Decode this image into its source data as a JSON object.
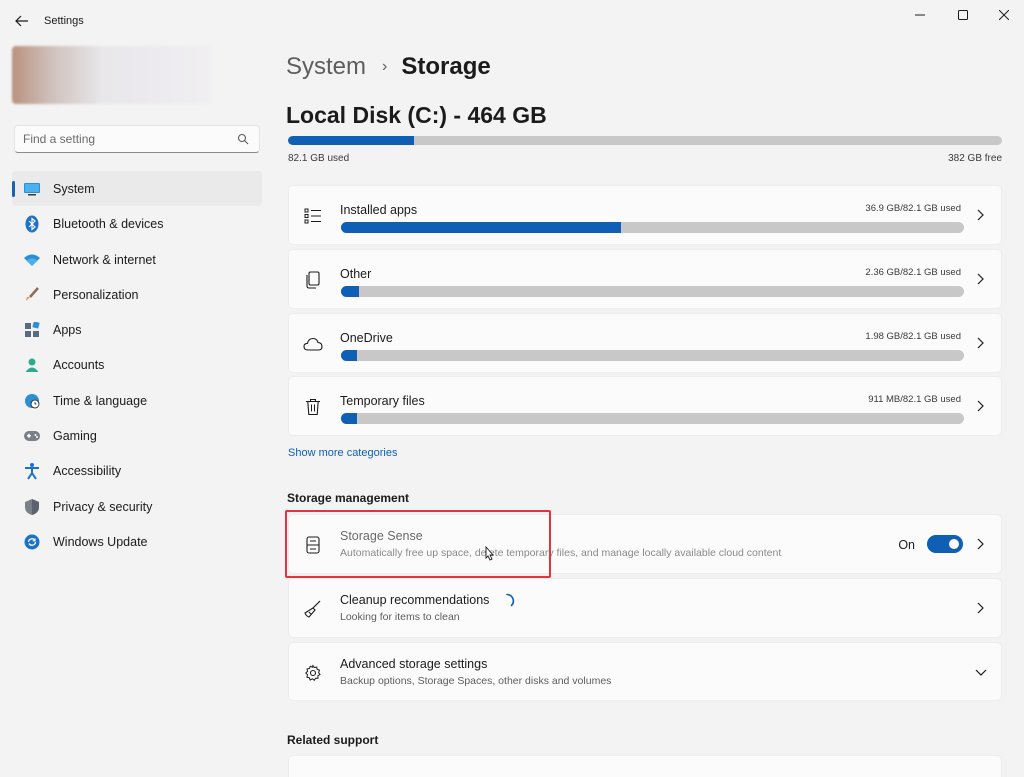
{
  "window": {
    "title": "Settings"
  },
  "sidebar": {
    "search_placeholder": "Find a setting",
    "items": [
      {
        "label": "System",
        "icon": "system-icon",
        "active": true
      },
      {
        "label": "Bluetooth & devices",
        "icon": "bluetooth-icon"
      },
      {
        "label": "Network & internet",
        "icon": "wifi-icon"
      },
      {
        "label": "Personalization",
        "icon": "brush-icon"
      },
      {
        "label": "Apps",
        "icon": "apps-icon"
      },
      {
        "label": "Accounts",
        "icon": "accounts-icon"
      },
      {
        "label": "Time & language",
        "icon": "globe-clock-icon"
      },
      {
        "label": "Gaming",
        "icon": "gamepad-icon"
      },
      {
        "label": "Accessibility",
        "icon": "accessibility-icon"
      },
      {
        "label": "Privacy & security",
        "icon": "shield-icon"
      },
      {
        "label": "Windows Update",
        "icon": "update-icon"
      }
    ]
  },
  "breadcrumb": {
    "parent": "System",
    "separator": "›",
    "current": "Storage"
  },
  "disk": {
    "title": "Local Disk (C:) - 464 GB",
    "used_label": "82.1 GB used",
    "free_label": "382 GB free",
    "used_fraction": 0.177
  },
  "categories": [
    {
      "name": "Installed apps",
      "usage": "36.9 GB/82.1 GB used",
      "fraction": 0.449,
      "icon": "list-icon"
    },
    {
      "name": "Other",
      "usage": "2.36 GB/82.1 GB used",
      "fraction": 0.029,
      "icon": "document-icon"
    },
    {
      "name": "OneDrive",
      "usage": "1.98 GB/82.1 GB used",
      "fraction": 0.024,
      "icon": "cloud-icon"
    },
    {
      "name": "Temporary files",
      "usage": "911 MB/82.1 GB used",
      "fraction": 0.011,
      "icon": "trash-icon"
    }
  ],
  "show_more": "Show more categories",
  "storage_management": {
    "title": "Storage management",
    "storage_sense": {
      "name": "Storage Sense",
      "description": "Automatically free up space, delete temporary files, and manage locally available cloud content",
      "toggle_label": "On",
      "enabled": true
    },
    "cleanup": {
      "name": "Cleanup recommendations",
      "description": "Looking for items to clean"
    },
    "advanced": {
      "name": "Advanced storage settings",
      "description": "Backup options, Storage Spaces, other disks and volumes"
    }
  },
  "related_support": {
    "title": "Related support"
  },
  "colors": {
    "accent": "#0f5fb5",
    "highlight": "#e0353d",
    "background": "#f3f3f3",
    "card": "#fbfbfb"
  }
}
